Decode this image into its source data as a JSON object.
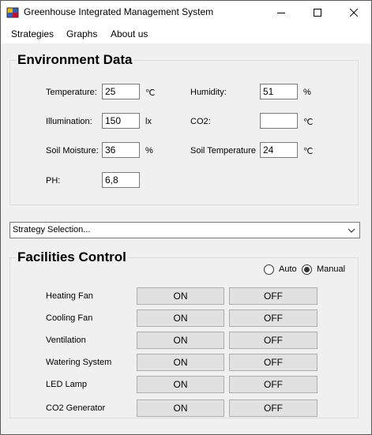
{
  "window": {
    "title": "Greenhouse Integrated Management System",
    "icons": {
      "app": "app-icon",
      "minimize": "minimize-icon",
      "maximize": "maximize-icon",
      "close": "close-icon"
    }
  },
  "menu": [
    "Strategies",
    "Graphs",
    "About us"
  ],
  "environment": {
    "title": "Environment Data",
    "temperature": {
      "label": "Temperature:",
      "value": "25",
      "unit": "℃"
    },
    "humidity": {
      "label": "Humidity:",
      "value": "51",
      "unit": "%"
    },
    "illumination": {
      "label": "Illumination:",
      "value": "150",
      "unit": "lx"
    },
    "co2": {
      "label": "CO2:",
      "value": "",
      "unit": "℃"
    },
    "soil_moisture": {
      "label": "Soil Moisture:",
      "value": "36",
      "unit": "%"
    },
    "soil_temperature": {
      "label": "Soil Temperature",
      "value": "24",
      "unit": "℃"
    },
    "ph": {
      "label": "PH:",
      "value": "6,8"
    }
  },
  "strategy": {
    "selected": "Strategy Selection..."
  },
  "facilities": {
    "title": "Facilities Control",
    "mode": {
      "auto_label": "Auto",
      "manual_label": "Manual",
      "selected": "Manual"
    },
    "on_label": "ON",
    "off_label": "OFF",
    "items": [
      {
        "label": "Heating Fan"
      },
      {
        "label": "Cooling Fan"
      },
      {
        "label": "Ventilation"
      },
      {
        "label": "Watering System"
      },
      {
        "label": "LED Lamp"
      },
      {
        "label": "CO2 Generator"
      }
    ]
  }
}
